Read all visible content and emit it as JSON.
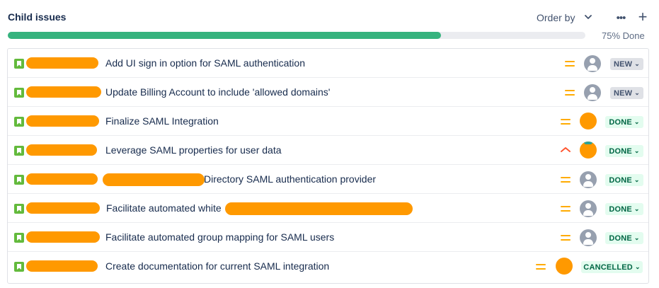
{
  "header": {
    "title": "Child issues",
    "order_by_label": "Order by",
    "order_by_icon": "chevron-down-icon",
    "more_icon": "more-horizontal-icon",
    "more_glyph": "•••",
    "add_icon": "plus-icon",
    "add_glyph": "+"
  },
  "progress": {
    "percent_done": 75,
    "label": "75% Done",
    "color": "#36b37e"
  },
  "colors": {
    "redaction": "#ff9900",
    "story": "#63ba3c",
    "priority_medium": "#ffab00",
    "priority_high": "#ff5630"
  },
  "issues": [
    {
      "summary": "Add UI sign in option for SAML authentication",
      "priority": "medium",
      "assignee": "unassigned",
      "status": "NEW"
    },
    {
      "summary": "Update Billing Account to include 'allowed domains'",
      "priority": "medium",
      "assignee": "unassigned",
      "status": "NEW"
    },
    {
      "summary": "Finalize SAML Integration",
      "priority": "medium",
      "assignee": "photo",
      "status": "DONE"
    },
    {
      "summary": "Leverage SAML properties for user data",
      "priority": "high",
      "assignee": "photo",
      "status": "DONE"
    },
    {
      "summary": "Directory SAML authentication provider",
      "priority": "medium",
      "assignee": "unassigned",
      "status": "DONE"
    },
    {
      "summary": "Facilitate automated white",
      "priority": "medium",
      "assignee": "unassigned",
      "status": "DONE"
    },
    {
      "summary": "Facilitate automated group mapping for SAML users",
      "priority": "medium",
      "assignee": "unassigned",
      "status": "DONE"
    },
    {
      "summary": "Create documentation for current SAML integration",
      "priority": "medium",
      "assignee": "photo",
      "status": "CANCELLED"
    }
  ]
}
